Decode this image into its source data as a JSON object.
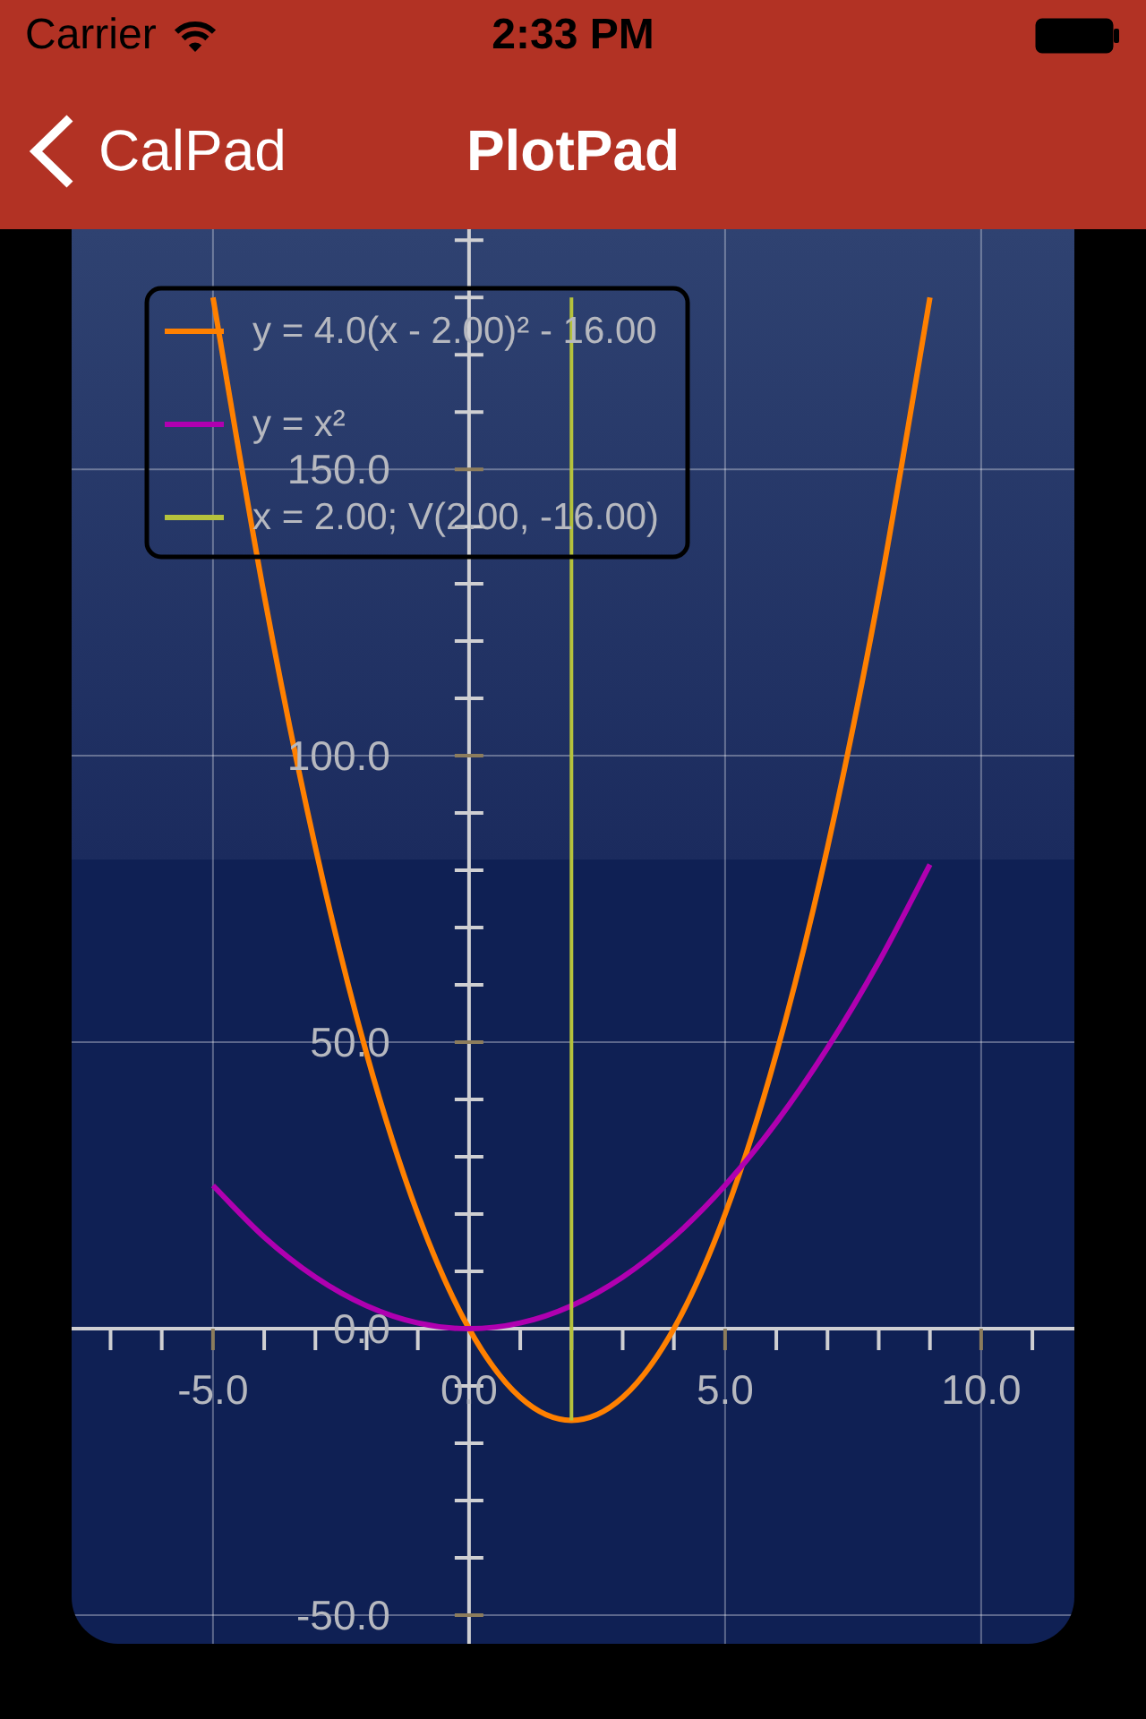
{
  "status_bar": {
    "carrier": "Carrier",
    "time": "2:33 PM"
  },
  "nav_bar": {
    "back_label": "CalPad",
    "title": "PlotPad"
  },
  "plot": {
    "chart_data": {
      "type": "line",
      "x": [
        -5,
        -4,
        -3,
        -2,
        -1,
        0,
        1,
        2,
        3,
        4,
        5,
        6,
        7,
        8,
        9
      ],
      "series": [
        {
          "name": "y = 4.0(x - 2.00)² - 16.00",
          "color": "#ff8000",
          "values": [
            180,
            128,
            84,
            48,
            20,
            0,
            -12,
            -16,
            -12,
            0,
            20,
            48,
            84,
            128,
            180
          ]
        },
        {
          "name": "y = x²",
          "color": "#b000b0",
          "values": [
            25,
            16,
            9,
            4,
            1,
            0,
            1,
            4,
            9,
            16,
            25,
            36,
            49,
            64,
            81
          ]
        }
      ],
      "ref_lines": [
        {
          "axis": "x",
          "value": 2,
          "label": "x = 2.00; V(2.00, -16.00)",
          "color": "#b5c23c"
        }
      ],
      "xlim": [
        -7.76,
        11.82
      ],
      "ylim": [
        -55,
        191.9
      ],
      "xticks": [
        {
          "value": -5,
          "label": "-5.0"
        },
        {
          "value": 0,
          "label": "0.0"
        },
        {
          "value": 5,
          "label": "5.0"
        },
        {
          "value": 10,
          "label": "10.0"
        }
      ],
      "yticks": [
        {
          "value": -50,
          "label": "-50.0"
        },
        {
          "value": 0,
          "label": "0.0"
        },
        {
          "value": 50,
          "label": "50.0"
        },
        {
          "value": 100,
          "label": "100.0"
        },
        {
          "value": 150,
          "label": "150.0"
        }
      ],
      "grid": true,
      "legend": true
    }
  }
}
